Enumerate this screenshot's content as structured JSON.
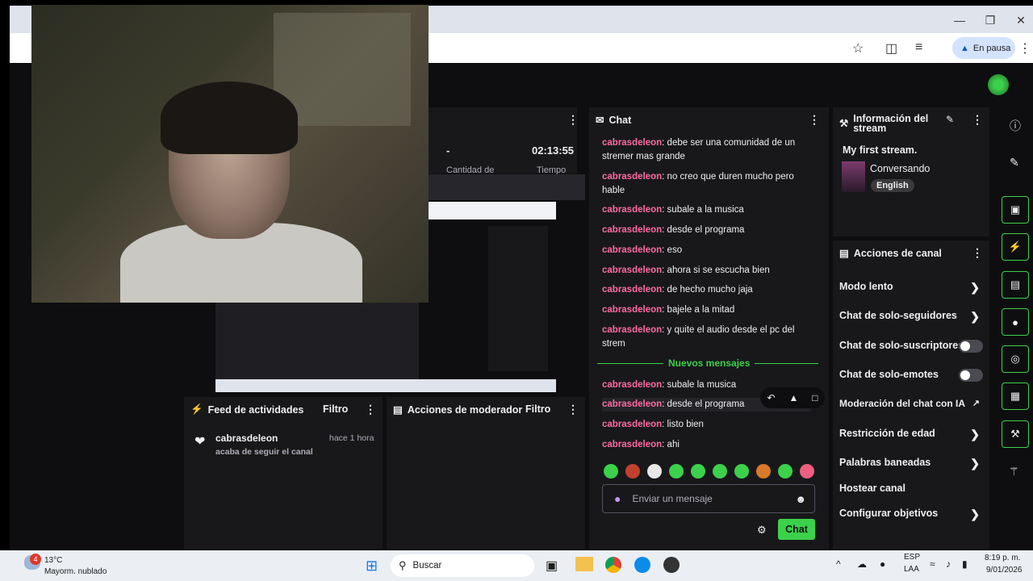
{
  "browser": {
    "paused_label": "En pausa"
  },
  "stats": {
    "value": "-",
    "time": "02:13:55",
    "label1": "Cantidad de",
    "label2": "Tiempo"
  },
  "chat": {
    "title": "Chat",
    "messages": [
      {
        "user": "cabrasdeleon",
        "text": ": debe ser una comunidad de un stremer mas grande"
      },
      {
        "user": "cabrasdeleon",
        "text": ": no creo que duren mucho pero hable"
      },
      {
        "user": "cabrasdeleon",
        "text": ": subale a la musica"
      },
      {
        "user": "cabrasdeleon",
        "text": ": desde el programa"
      },
      {
        "user": "cabrasdeleon",
        "text": ": eso"
      },
      {
        "user": "cabrasdeleon",
        "text": ": ahora si se escucha bien"
      },
      {
        "user": "cabrasdeleon",
        "text": ": de hecho mucho jaja"
      },
      {
        "user": "cabrasdeleon",
        "text": ": bajele a la mitad"
      },
      {
        "user": "cabrasdeleon",
        "text": ": y quite el audio desde el pc del strem"
      }
    ],
    "new_messages_label": "Nuevos mensajes",
    "new_messages": [
      {
        "user": "cabrasdeleon",
        "text": ": subale la musica"
      },
      {
        "user": "cabrasdeleon",
        "text": ": desde el programa"
      },
      {
        "user": "cabrasdeleon",
        "text": ": listo bien"
      },
      {
        "user": "cabrasdeleon",
        "text": ": ahi"
      }
    ],
    "input_placeholder": "Enviar un mensaje",
    "send_label": "Chat"
  },
  "stream_info": {
    "title": "Información del stream",
    "stream_title": "My first stream.",
    "category": "Conversando",
    "language": "English"
  },
  "channel_actions": {
    "title": "Acciones de canal",
    "items": [
      {
        "label": "Modo lento",
        "control": "chevron"
      },
      {
        "label": "Chat de solo-seguidores",
        "control": "chevron"
      },
      {
        "label": "Chat de solo-suscriptores",
        "control": "toggle"
      },
      {
        "label": "Chat de solo-emotes",
        "control": "toggle"
      },
      {
        "label": "Moderación del chat con IA",
        "control": "external"
      },
      {
        "label": "Restricción de edad",
        "control": "chevron"
      },
      {
        "label": "Palabras baneadas",
        "control": "chevron"
      },
      {
        "label": "Hostear canal",
        "control": "none"
      },
      {
        "label": "Configurar objetivos",
        "control": "chevron"
      }
    ]
  },
  "activity_feed": {
    "title": "Feed de actividades",
    "filter": "Filtro",
    "item_user": "cabrasdeleon",
    "item_time": "hace 1 hora",
    "item_text": "acaba de seguir el canal"
  },
  "mod_actions": {
    "title": "Acciones de moderador",
    "filter": "Filtro"
  },
  "taskbar": {
    "weather_temp": "13°C",
    "weather_desc": "Mayorm. nublado",
    "weather_badge": "4",
    "search_label": "Buscar",
    "lang_top": "ESP",
    "lang_bottom": "LAA",
    "time": "8:19 p. m.",
    "date": "9/01/2026"
  },
  "colors": {
    "accent_green": "#3cd14b",
    "username_pink": "#ff6ba1",
    "panel_bg": "#18181b",
    "app_bg": "#0e0e10"
  }
}
